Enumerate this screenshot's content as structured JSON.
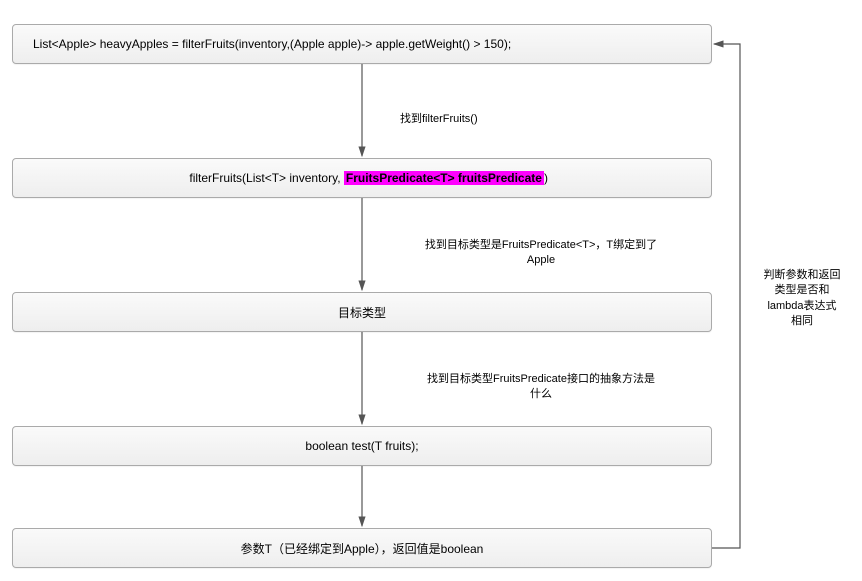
{
  "nodes": {
    "n1": "List<Apple> heavyApples = filterFruits(inventory,(Apple apple)-> apple.getWeight() > 150);",
    "n2_prefix": "filterFruits(List<T> inventory, ",
    "n2_highlight": "FruitsPredicate<T> fruitsPredicate",
    "n2_suffix": ")",
    "n3": "目标类型",
    "n4": "boolean test(T fruits);",
    "n5": "参数T（已经绑定到Apple），返回值是boolean"
  },
  "edges": {
    "e1": "找到filterFruits()",
    "e2": "找到目标类型是FruitsPredicate<T>，T绑定到了\nApple",
    "e3": "找到目标类型FruitsPredicate接口的抽象方法是\n什么",
    "e_back": "判断参数和返回\n类型是否和\nlambda表达式\n相同"
  },
  "chart_data": {
    "type": "flowchart",
    "nodes": [
      {
        "id": "n1",
        "text": "List<Apple> heavyApples = filterFruits(inventory,(Apple apple)-> apple.getWeight() > 150);"
      },
      {
        "id": "n2",
        "text": "filterFruits(List<T> inventory, FruitsPredicate<T> fruitsPredicate)",
        "highlight_span": "FruitsPredicate<T> fruitsPredicate"
      },
      {
        "id": "n3",
        "text": "目标类型"
      },
      {
        "id": "n4",
        "text": "boolean test(T fruits);"
      },
      {
        "id": "n5",
        "text": "参数T（已经绑定到Apple），返回值是boolean"
      }
    ],
    "edges": [
      {
        "from": "n1",
        "to": "n2",
        "label": "找到filterFruits()"
      },
      {
        "from": "n2",
        "to": "n3",
        "label": "找到目标类型是FruitsPredicate<T>，T绑定到了Apple"
      },
      {
        "from": "n3",
        "to": "n4",
        "label": "找到目标类型FruitsPredicate接口的抽象方法是什么"
      },
      {
        "from": "n4",
        "to": "n5",
        "label": ""
      },
      {
        "from": "n5",
        "to": "n1",
        "label": "判断参数和返回类型是否和lambda表达式相同"
      }
    ]
  }
}
